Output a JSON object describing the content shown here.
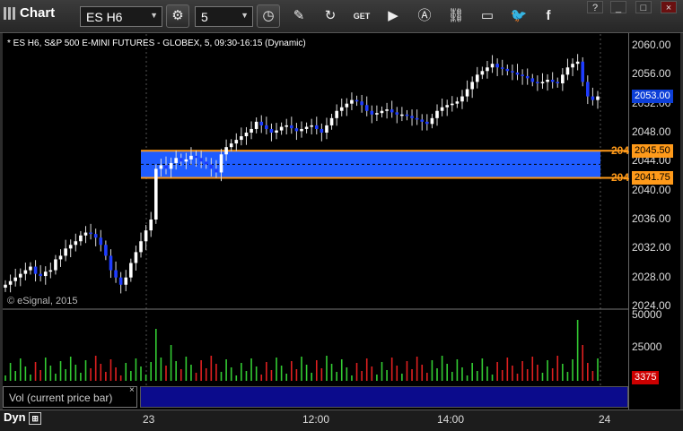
{
  "toolbar": {
    "app_title": "Chart",
    "symbol": "ES H6",
    "interval": "5",
    "icons": [
      "gear-icon",
      "clock-icon",
      "pencil-icon",
      "refresh-icon",
      "get-icon",
      "play-icon",
      "alert-icon",
      "link-icon",
      "comment-icon",
      "twitter-icon",
      "facebook-icon"
    ]
  },
  "window": {
    "help": "?",
    "minimize": "_",
    "maximize": "□",
    "close": "×"
  },
  "chart": {
    "title": "* ES H6, S&P 500 E-MINI FUTURES - GLOBEX, 5, 09:30-16:15 (Dynamic)",
    "copyright": "© eSignal, 2015",
    "price_tag": "2053.00",
    "zone_top_label": "2045.50",
    "zone_bottom_label": "2041.75",
    "zone_top_short": "204",
    "zone_bottom_short": "204",
    "vol_tag": "3375",
    "vol_label": "Vol (current price bar)",
    "vol_close": "×",
    "dyn_label": "Dyn"
  },
  "chart_data": {
    "type": "candlestick",
    "yticks": [
      "2060.00",
      "2056.00",
      "2052.00",
      "2048.00",
      "2044.00",
      "2040.00",
      "2036.00",
      "2032.00",
      "2028.00",
      "2024.00"
    ],
    "ylim": [
      2024,
      2061
    ],
    "vol_ticks": [
      "50000",
      "25000"
    ],
    "xticks": [
      "23",
      "12:00",
      "14:00",
      "24"
    ],
    "zone": {
      "top": 2045.5,
      "bottom": 2041.75
    },
    "closes": [
      2027,
      2027.5,
      2028,
      2028.5,
      2029,
      2029.5,
      2028.5,
      2028.2,
      2028.8,
      2029,
      2030.5,
      2031,
      2032,
      2032.5,
      2033,
      2033.8,
      2034.2,
      2034,
      2033.5,
      2032.5,
      2031,
      2029,
      2028,
      2027,
      2028,
      2030,
      2031.5,
      2033,
      2034.5,
      2036,
      2043,
      2043.5,
      2043,
      2043.8,
      2044.5,
      2044,
      2044.3,
      2044.8,
      2044.5,
      2044,
      2043.6,
      2043,
      2042.5,
      2045,
      2046,
      2046.5,
      2047,
      2047.5,
      2048,
      2048.5,
      2049.5,
      2049,
      2048.5,
      2048,
      2048.3,
      2048.8,
      2049,
      2048.6,
      2048.2,
      2048.5,
      2048.8,
      2049,
      2048.5,
      2048,
      2049,
      2050,
      2051,
      2051.5,
      2052,
      2052.5,
      2052.3,
      2051.8,
      2051,
      2050.5,
      2050.7,
      2051,
      2051.2,
      2050.8,
      2050.5,
      2050.5,
      2050.3,
      2050,
      2049.8,
      2049.5,
      2049.2,
      2050,
      2051,
      2051.5,
      2051.8,
      2052,
      2052.3,
      2053,
      2054,
      2055,
      2056,
      2056.5,
      2057,
      2057.5,
      2057,
      2056.8,
      2056.5,
      2056.3,
      2056,
      2055.8,
      2055.5,
      2055,
      2054.8,
      2055,
      2055.3,
      2055,
      2054.8,
      2056,
      2057,
      2057.5,
      2057.8,
      2055,
      2053,
      2052.5,
      2053
    ]
  }
}
